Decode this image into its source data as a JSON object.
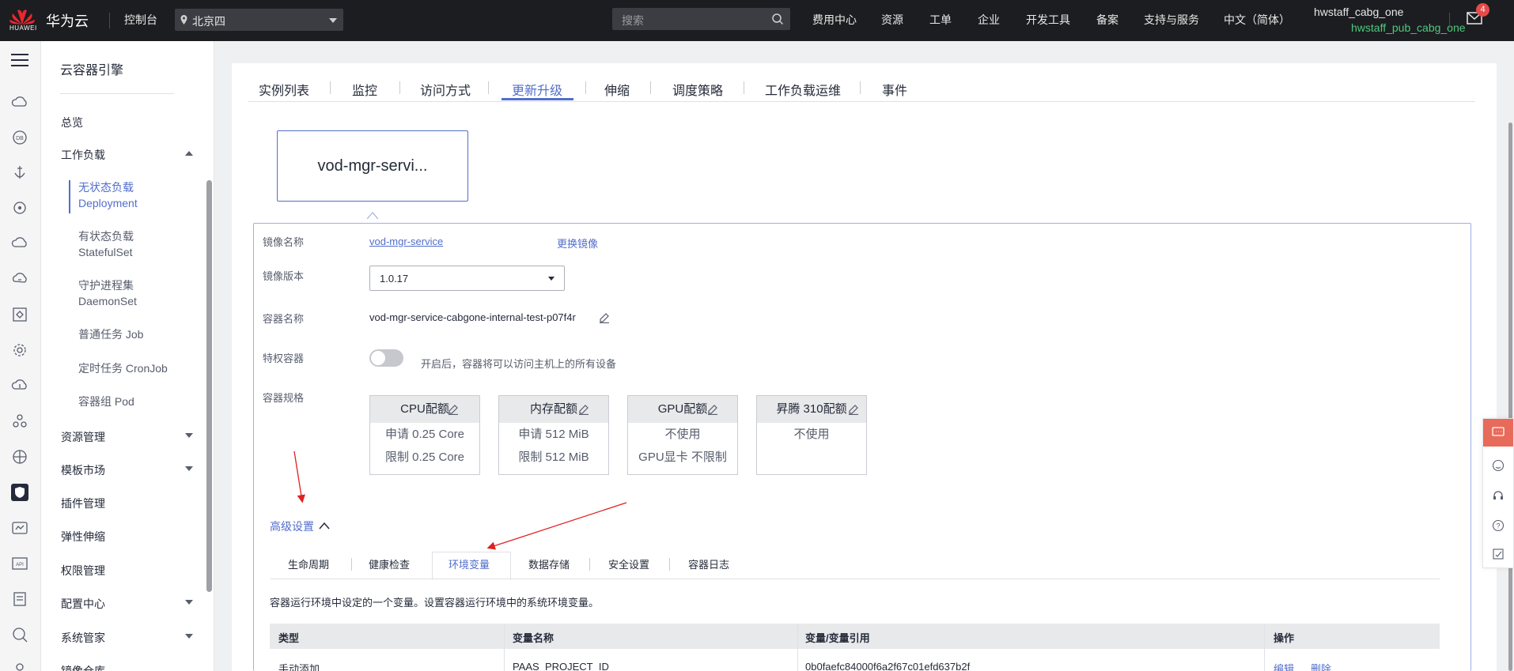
{
  "topbar": {
    "logo_text": "HUAWEI",
    "brand": "华为云",
    "console": "控制台",
    "region": "北京四",
    "search_placeholder": "搜索",
    "nav": [
      "费用中心",
      "资源",
      "工单",
      "企业",
      "开发工具",
      "备案",
      "支持与服务",
      "中文（简体）"
    ],
    "user": "hwstaff_cabg_one",
    "user_sub": "hwstaff_pub_cabg_one",
    "mail_badge": "4"
  },
  "sidebar": {
    "title": "云容器引擎",
    "items": [
      {
        "label": "总览"
      },
      {
        "label": "工作负载",
        "expanded": true
      },
      {
        "label": "资源管理"
      },
      {
        "label": "模板市场"
      },
      {
        "label": "插件管理"
      },
      {
        "label": "弹性伸缩"
      },
      {
        "label": "权限管理"
      },
      {
        "label": "配置中心"
      },
      {
        "label": "系统管家"
      },
      {
        "label": "镜像仓库"
      }
    ],
    "sub_items": [
      {
        "cn": "无状态负载",
        "en": "Deployment",
        "active": true
      },
      {
        "cn": "有状态负载",
        "en": "StatefulSet"
      },
      {
        "cn": "守护进程集",
        "en": "DaemonSet"
      },
      {
        "cn": "普通任务 Job",
        "en": ""
      },
      {
        "cn": "定时任务 CronJob",
        "en": ""
      },
      {
        "cn": "容器组 Pod",
        "en": ""
      }
    ]
  },
  "tabs": [
    "实例列表",
    "监控",
    "访问方式",
    "更新升级",
    "伸缩",
    "调度策略",
    "工作负载运维",
    "事件"
  ],
  "active_tab": "更新升级",
  "container_tile": "vod-mgr-servi...",
  "form": {
    "image_name_label": "镜像名称",
    "image_name": "vod-mgr-service",
    "change_image": "更换镜像",
    "image_version_label": "镜像版本",
    "image_version": "1.0.17",
    "container_name_label": "容器名称",
    "container_name": "vod-mgr-service-cabgone-internal-test-p07f4r",
    "privileged_label": "特权容器",
    "privileged_on": false,
    "privileged_hint": "开启后，容器将可以访问主机上的所有设备",
    "spec_label": "容器规格",
    "specs": [
      {
        "title": "CPU配额",
        "row1": "申请 0.25 Core",
        "row2": "限制 0.25 Core"
      },
      {
        "title": "内存配额",
        "row1": "申请 512 MiB",
        "row2": "限制 512 MiB"
      },
      {
        "title": "GPU配额",
        "row1": "不使用",
        "row2": "GPU显卡 不限制"
      },
      {
        "title": "昇腾 310配额",
        "row1": "不使用",
        "row2": ""
      }
    ]
  },
  "advanced": "高级设置",
  "sub_tabs": [
    "生命周期",
    "健康检查",
    "环境变量",
    "数据存储",
    "安全设置",
    "容器日志"
  ],
  "active_sub_tab": "环境变量",
  "env_desc": "容器运行环境中设定的一个变量。设置容器运行环境中的系统环境变量。",
  "env_table": {
    "headers": [
      "类型",
      "变量名称",
      "变量/变量引用",
      "操作"
    ],
    "rows": [
      {
        "type": "手动添加",
        "name": "PAAS_PROJECT_ID",
        "value": "0b0faefc84000f6a2f67c01efd637b2f",
        "edit": "编辑",
        "delete": "删除"
      }
    ]
  },
  "colors": {
    "accent": "#526ecc",
    "topbar": "#1c1d20",
    "user_sub": "#4ec97f",
    "badge": "#e64a4a",
    "annotation_arrow": "#e02020"
  }
}
